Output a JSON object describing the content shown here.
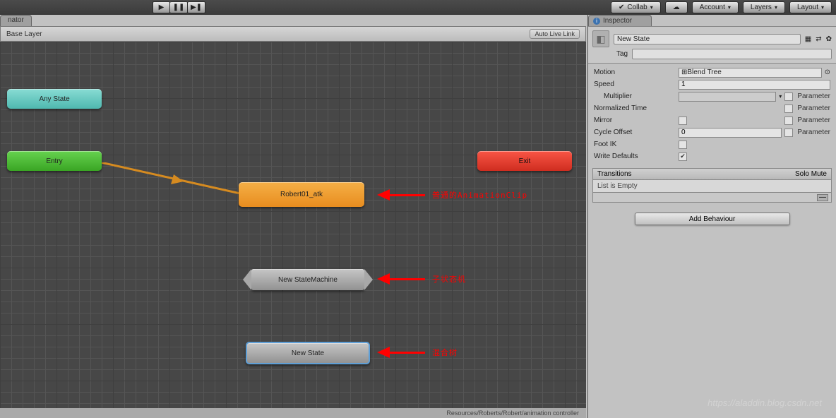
{
  "toolbar": {
    "collab": "Collab",
    "account": "Account",
    "layers": "Layers",
    "layout": "Layout"
  },
  "animator": {
    "tab": "nator",
    "crumb": "Base Layer",
    "live_link": "Auto Live Link"
  },
  "nodes": {
    "any_state": "Any State",
    "entry": "Entry",
    "exit": "Exit",
    "orange": "Robert01_atk",
    "hex": "New StateMachine",
    "grey": "New State"
  },
  "annotations": {
    "a1": "普通的AnimationClip",
    "a2": "子状态机",
    "a3": "混合树"
  },
  "inspector": {
    "tab": "Inspector",
    "name": "New State",
    "tag": "Tag",
    "motion_lbl": "Motion",
    "motion_val": "Blend Tree",
    "speed_lbl": "Speed",
    "speed_val": "1",
    "multiplier_lbl": "Multiplier",
    "norm_time_lbl": "Normalized Time",
    "mirror_lbl": "Mirror",
    "cycle_lbl": "Cycle Offset",
    "cycle_val": "0",
    "footik_lbl": "Foot IK",
    "write_def_lbl": "Write Defaults",
    "parameter": "Parameter",
    "transitions": "Transitions",
    "solo_mute": "Solo  Mute",
    "list_empty": "List is Empty",
    "add_behaviour": "Add Behaviour"
  },
  "status": "Resources/Roberts/Robert/animation controller",
  "watermark": "https://aladdin.blog.csdn.net"
}
